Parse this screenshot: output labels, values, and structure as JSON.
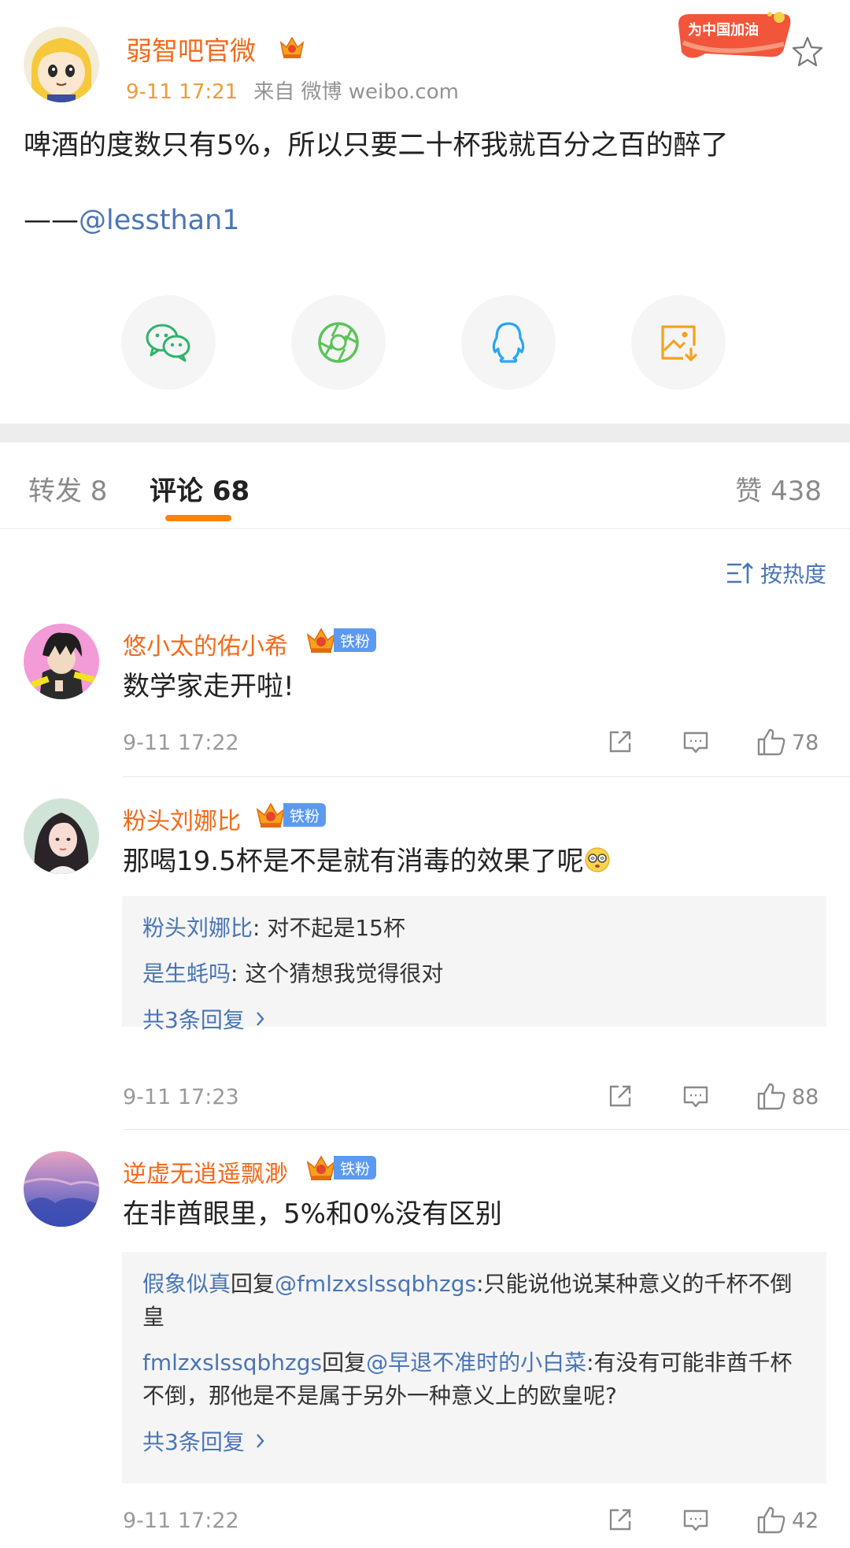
{
  "post": {
    "author": "弱智吧官微",
    "time": "9-11 17:21",
    "source": "来自 微博 weibo.com",
    "badge_text": "为中国加油",
    "text": "啤酒的度数只有5%，所以只要二十杯我就百分之百的醉了",
    "sig_prefix": "——",
    "sig_mention": "@lessthan1"
  },
  "share": [
    "wechat-icon",
    "moments-icon",
    "qq-icon",
    "save-image-icon"
  ],
  "tabs": {
    "repost": "转发 8",
    "comment": "评论 68",
    "like": "赞 438"
  },
  "sort_label": "按热度",
  "comments": [
    {
      "name": "悠小太的佑小希",
      "fan_label": "铁粉",
      "text": "数学家走开啦!",
      "time": "9-11 17:22",
      "likes": "78"
    },
    {
      "name": "粉头刘娜比",
      "fan_label": "铁粉",
      "text": "那喝19.5杯是不是就有消毒的效果了呢",
      "time": "9-11 17:23",
      "likes": "88",
      "replies": [
        {
          "user": "粉头刘娜比",
          "text": ": 对不起是15杯"
        },
        {
          "user": "是生蚝吗",
          "text": ": 这个猜想我觉得很对"
        }
      ],
      "more": "共3条回复"
    },
    {
      "name": "逆虚无逍遥飘渺",
      "fan_label": "铁粉",
      "text": "在非酋眼里，5%和0%没有区别",
      "time": "9-11 17:22",
      "likes": "42",
      "replies": [
        {
          "user": "假象似真",
          "mid": "回复",
          "mention": "@fmlzxslssqbhzgs",
          "text": ":只能说他说某种意义的千杯不倒皇"
        },
        {
          "user": "fmlzxslssqbhzgs",
          "mid": "回复",
          "mention": "@早退不准时的小白菜",
          "text": ":有没有可能非酋千杯不倒，那他是不是属于另外一种意义上的欧皇呢?"
        }
      ],
      "more": "共3条回复"
    }
  ],
  "colors": {
    "name_orange": "#f26a1b",
    "link_blue": "#4a75b5",
    "tab_accent": "#ff8200"
  }
}
